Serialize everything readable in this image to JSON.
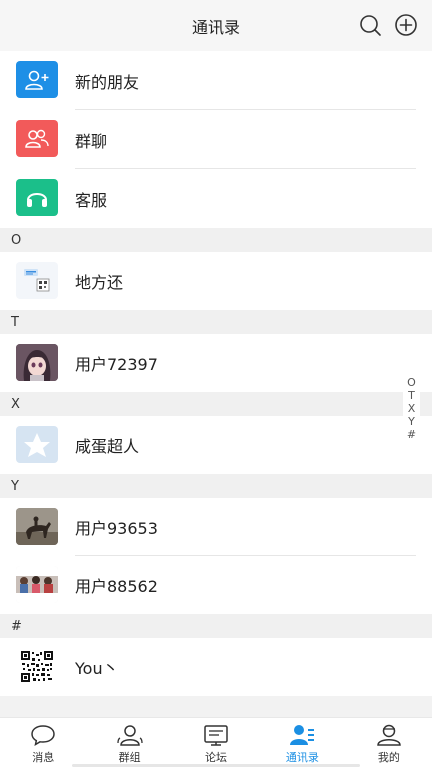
{
  "header": {
    "title": "通讯录"
  },
  "top_items": [
    {
      "label": "新的朋友",
      "icon": "add-friend-icon",
      "color": "#1e8fe6"
    },
    {
      "label": "群聊",
      "icon": "group-chat-icon",
      "color": "#f25a5a"
    },
    {
      "label": "客服",
      "icon": "headset-icon",
      "color": "#1bbf8a"
    }
  ],
  "sections": [
    {
      "letter": "O",
      "contacts": [
        {
          "name": "地方还",
          "avatar": "qr-card-avatar"
        }
      ]
    },
    {
      "letter": "T",
      "contacts": [
        {
          "name": "用户72397",
          "avatar": "anime-girl-avatar"
        }
      ]
    },
    {
      "letter": "X",
      "contacts": [
        {
          "name": "咸蛋超人",
          "avatar": "star-placeholder-avatar"
        }
      ]
    },
    {
      "letter": "Y",
      "contacts": [
        {
          "name": "用户93653",
          "avatar": "horse-rider-avatar"
        },
        {
          "name": "用户88562",
          "avatar": "group-photo-avatar"
        }
      ]
    },
    {
      "letter": "#",
      "contacts": [
        {
          "name": "You丶",
          "avatar": "qr-code-avatar"
        }
      ]
    }
  ],
  "index_bar": [
    "O",
    "T",
    "X",
    "Y",
    "#"
  ],
  "bottom_nav": [
    {
      "label": "消息",
      "icon": "chat-bubble-icon",
      "active": false
    },
    {
      "label": "群组",
      "icon": "group-icon",
      "active": false
    },
    {
      "label": "论坛",
      "icon": "forum-icon",
      "active": false
    },
    {
      "label": "通讯录",
      "icon": "contacts-icon",
      "active": true
    },
    {
      "label": "我的",
      "icon": "profile-icon",
      "active": false
    }
  ],
  "colors": {
    "accent": "#1b8fe3"
  }
}
